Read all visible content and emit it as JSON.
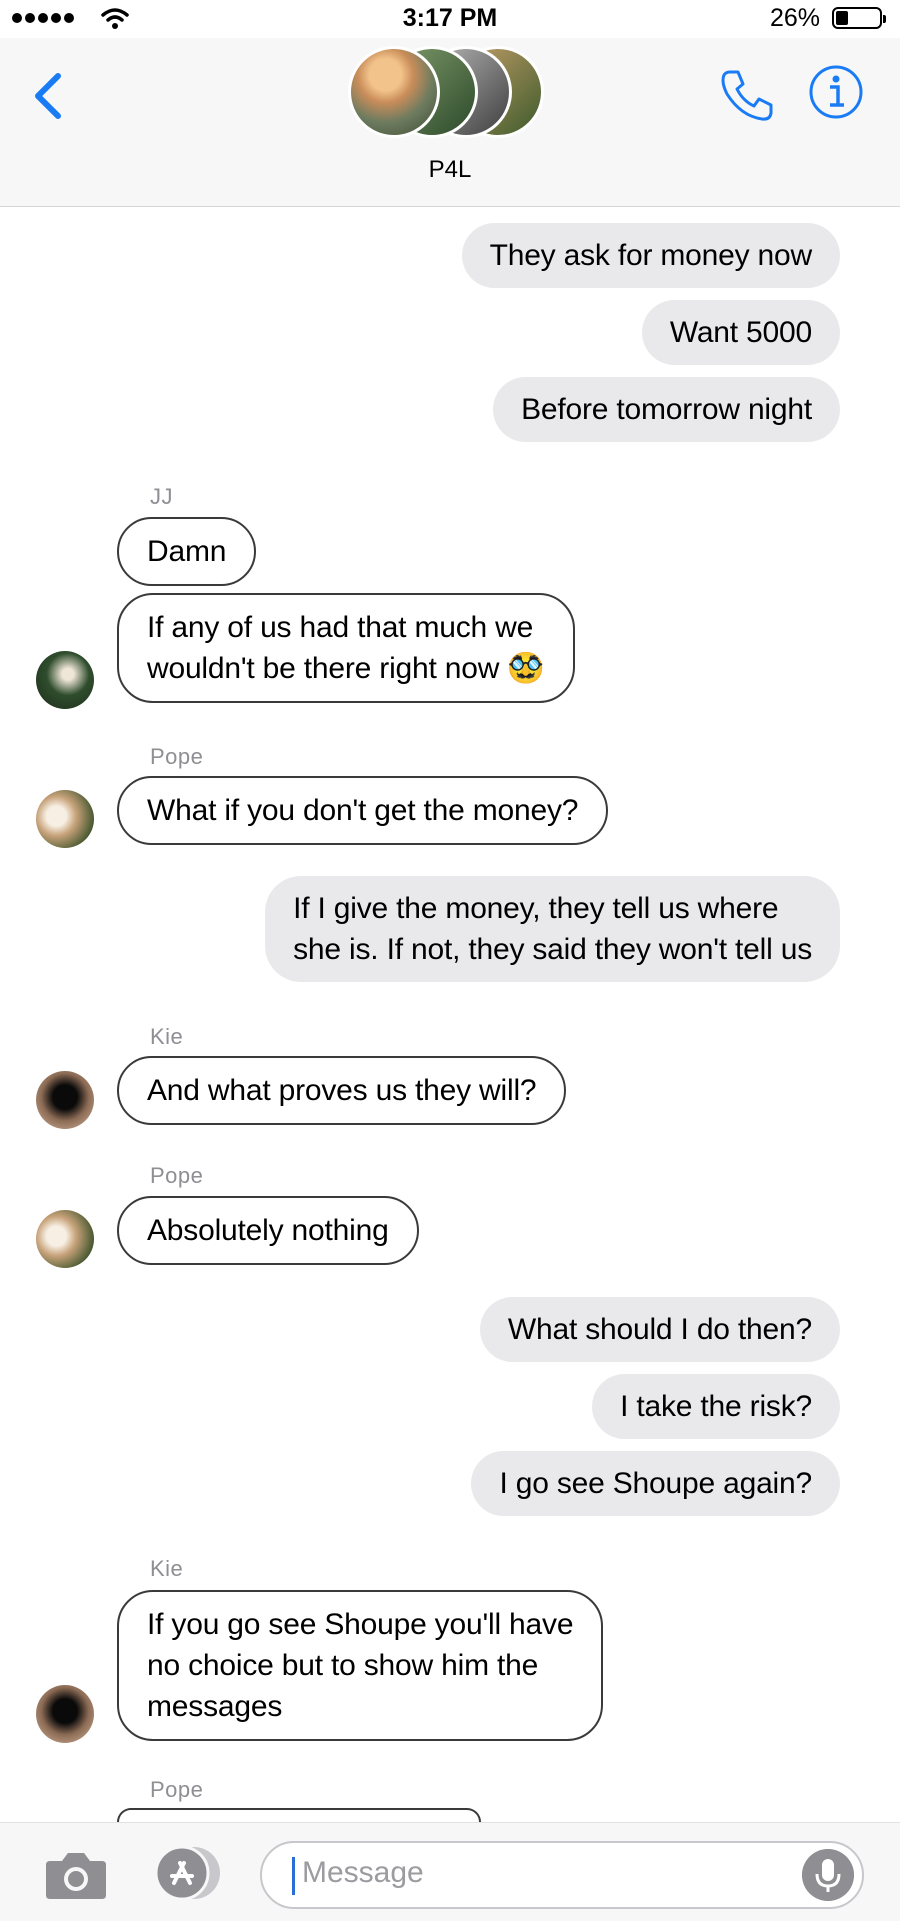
{
  "status_bar": {
    "time": "3:17 PM",
    "battery_pct": "26%",
    "battery_level": 0.26
  },
  "header": {
    "group_name": "P4L"
  },
  "messages": [
    {
      "type": "sent",
      "text": "They ask for money now"
    },
    {
      "type": "sent",
      "text": "Want 5000"
    },
    {
      "type": "sent",
      "text": "Before tomorrow night"
    },
    {
      "type": "sender",
      "text": "JJ"
    },
    {
      "type": "recv",
      "text": "Damn"
    },
    {
      "type": "recv",
      "lines": [
        "If any of us had that much we",
        "wouldn't be there right now 🥸"
      ]
    },
    {
      "type": "sender",
      "text": "Pope"
    },
    {
      "type": "recv",
      "text": "What if you don't get the money?"
    },
    {
      "type": "sent",
      "lines": [
        "If I give the money, they tell us where",
        "she is. If not, they said they won't tell us"
      ]
    },
    {
      "type": "sender",
      "text": "Kie"
    },
    {
      "type": "recv",
      "text": "And what proves us they will?"
    },
    {
      "type": "sender",
      "text": "Pope"
    },
    {
      "type": "recv",
      "text": "Absolutely nothing"
    },
    {
      "type": "sent",
      "text": "What should I do then?"
    },
    {
      "type": "sent",
      "text": "I take the risk?"
    },
    {
      "type": "sent",
      "text": "I go see Shoupe again?"
    },
    {
      "type": "sender",
      "text": "Kie"
    },
    {
      "type": "recv",
      "lines": [
        "If you go see Shoupe you'll have",
        "no choice but to show him the",
        "messages"
      ]
    },
    {
      "type": "sender",
      "text": "Pope"
    }
  ],
  "composer": {
    "placeholder": "Message"
  },
  "colors": {
    "accent": "#1a7cf5",
    "sent_bubble": "#e9e9eb",
    "meta_text": "#8e8e93"
  }
}
